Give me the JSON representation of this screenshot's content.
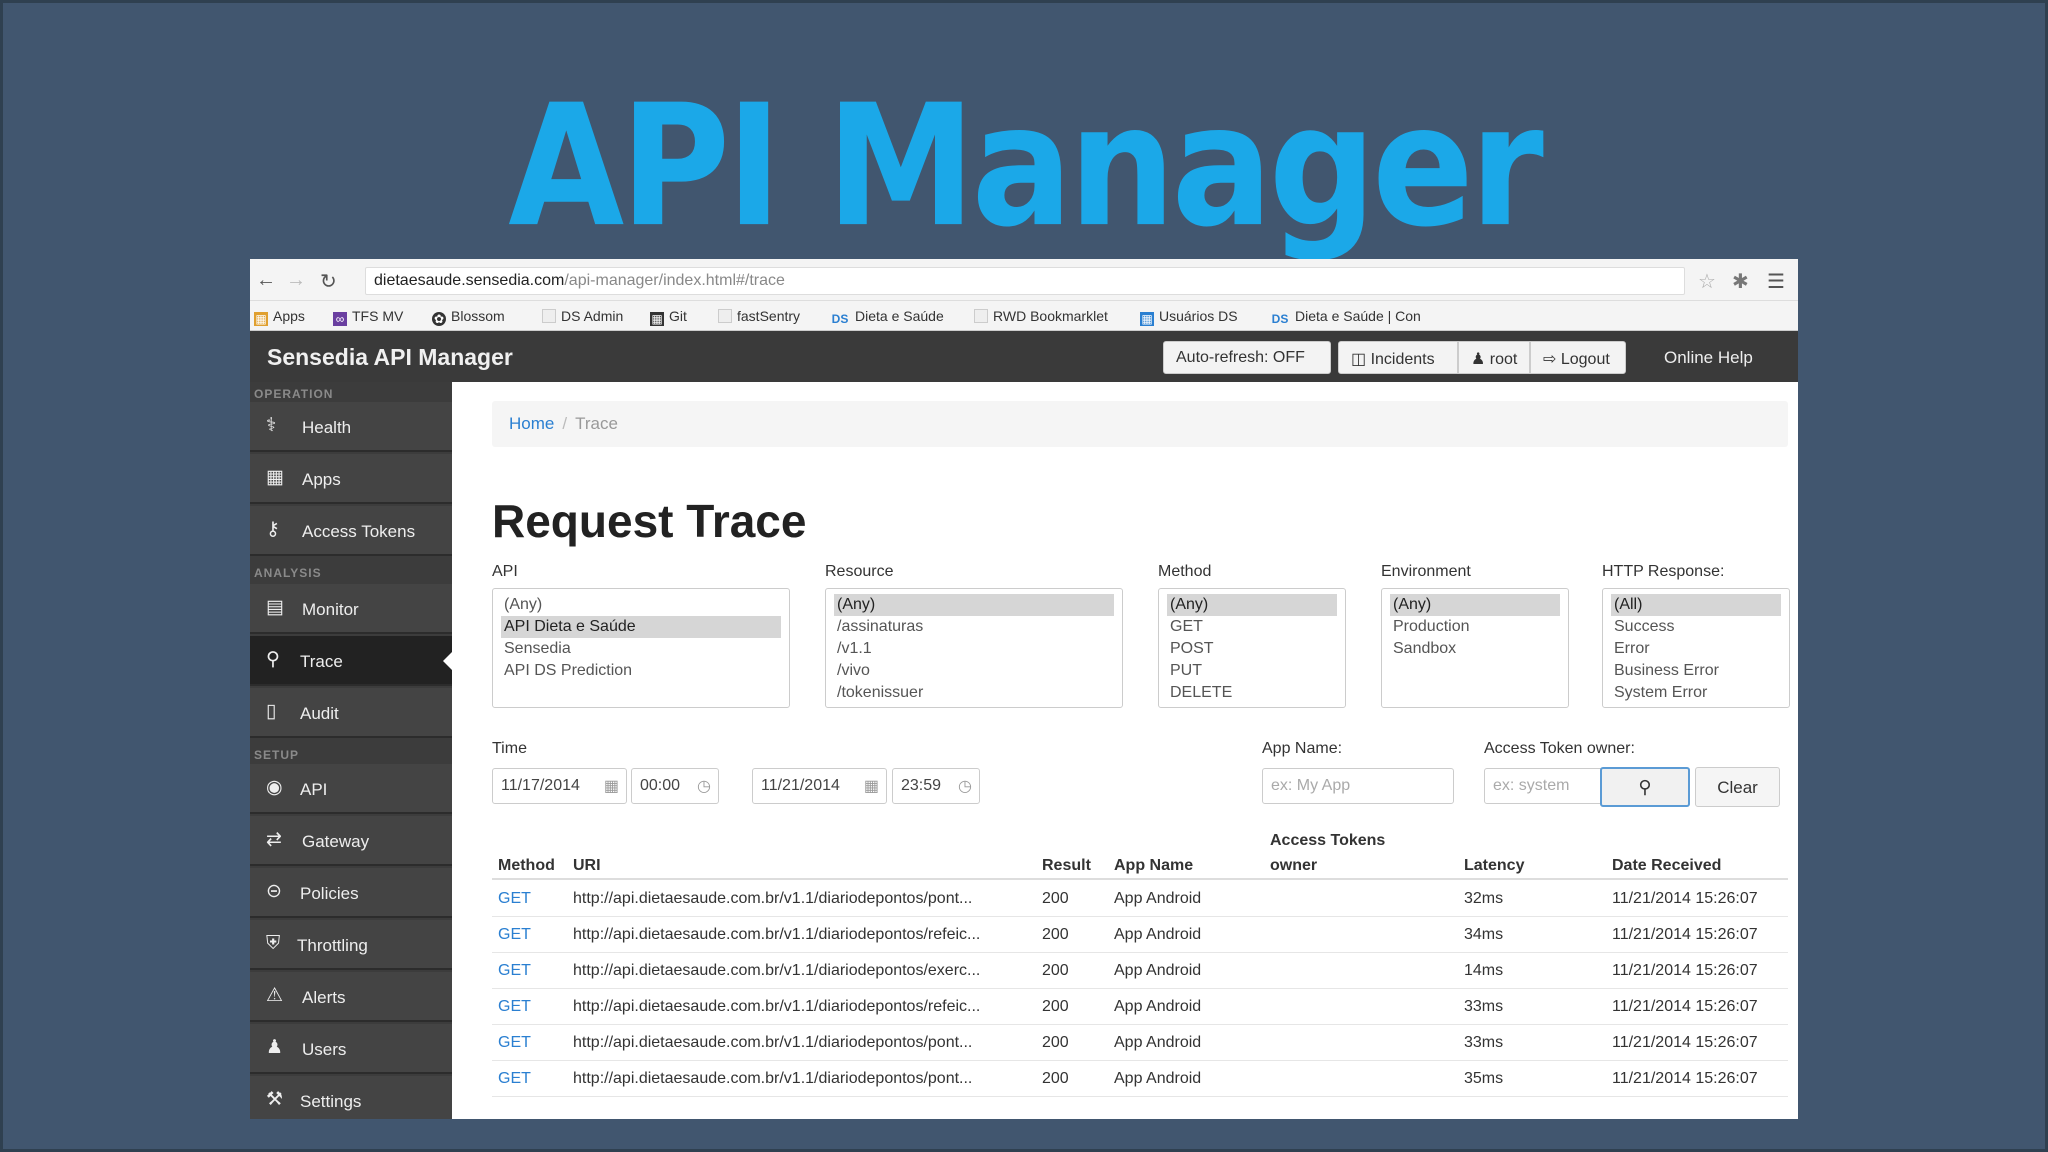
{
  "slide": {
    "title": "API Manager"
  },
  "browser": {
    "url_host": "dietaesaude.sensedia.com",
    "url_path": "/api-manager/index.html#/trace",
    "bookmarks": [
      "Apps",
      "TFS MV",
      "Blossom",
      "DS Admin",
      "Git",
      "fastSentry",
      "Dieta e Saúde",
      "RWD Bookmarklet",
      "Usuários DS",
      "Dieta e Saúde | Con"
    ]
  },
  "header": {
    "brand": "Sensedia API Manager",
    "auto_refresh": "Auto-refresh: OFF",
    "incidents": "Incidents",
    "user": "root",
    "logout": "Logout",
    "online_help": "Online Help"
  },
  "sidebar": {
    "sections": [
      "OPERATION",
      "ANALYSIS",
      "SETUP"
    ],
    "items": [
      {
        "label": "Health",
        "icon": "stethoscope-icon"
      },
      {
        "label": "Apps",
        "icon": "grid-icon"
      },
      {
        "label": "Access Tokens",
        "icon": "key-icon"
      },
      {
        "label": "Monitor",
        "icon": "chart-icon"
      },
      {
        "label": "Trace",
        "icon": "search-icon"
      },
      {
        "label": "Audit",
        "icon": "book-icon"
      },
      {
        "label": "API",
        "icon": "globe-icon"
      },
      {
        "label": "Gateway",
        "icon": "shuffle-icon"
      },
      {
        "label": "Policies",
        "icon": "minus-circle-icon"
      },
      {
        "label": "Throttling",
        "icon": "shield-icon"
      },
      {
        "label": "Alerts",
        "icon": "warning-icon"
      },
      {
        "label": "Users",
        "icon": "users-icon"
      },
      {
        "label": "Settings",
        "icon": "wrench-icon"
      }
    ]
  },
  "breadcrumb": {
    "home": "Home",
    "current": "Trace"
  },
  "page_title": "Request Trace",
  "filters": {
    "api": {
      "label": "API",
      "options": [
        "(Any)",
        "API Dieta e Saúde",
        "Sensedia",
        "API DS Prediction"
      ]
    },
    "resource": {
      "label": "Resource",
      "options": [
        "(Any)",
        "/assinaturas",
        "/v1.1",
        "/vivo",
        "/tokenissuer"
      ]
    },
    "method": {
      "label": "Method",
      "options": [
        "(Any)",
        "GET",
        "POST",
        "PUT",
        "DELETE"
      ]
    },
    "environment": {
      "label": "Environment",
      "options": [
        "(Any)",
        "Production",
        "Sandbox"
      ]
    },
    "http_response": {
      "label": "HTTP Response:",
      "options": [
        "(All)",
        "Success",
        "Error",
        "Business Error",
        "System Error"
      ]
    },
    "time_label": "Time",
    "from_date": "11/17/2014",
    "from_time": "00:00",
    "to_date": "11/21/2014",
    "to_time": "23:59",
    "app_name_label": "App Name:",
    "app_name_placeholder": "ex: My App",
    "token_owner_label": "Access Token owner:",
    "token_owner_placeholder": "ex: system",
    "clear": "Clear"
  },
  "table": {
    "headers": {
      "method": "Method",
      "uri": "URI",
      "result": "Result",
      "app_name": "App Name",
      "token_owner_1": "Access Tokens",
      "token_owner_2": "owner",
      "latency": "Latency",
      "date": "Date Received"
    },
    "rows": [
      {
        "method": "GET",
        "uri": "http://api.dietaesaude.com.br/v1.1/diariodepontos/pont...",
        "result": "200",
        "app": "App Android",
        "latency": "32ms",
        "date": "11/21/2014 15:26:07"
      },
      {
        "method": "GET",
        "uri": "http://api.dietaesaude.com.br/v1.1/diariodepontos/refeic...",
        "result": "200",
        "app": "App Android",
        "latency": "34ms",
        "date": "11/21/2014 15:26:07"
      },
      {
        "method": "GET",
        "uri": "http://api.dietaesaude.com.br/v1.1/diariodepontos/exerc...",
        "result": "200",
        "app": "App Android",
        "latency": "14ms",
        "date": "11/21/2014 15:26:07"
      },
      {
        "method": "GET",
        "uri": "http://api.dietaesaude.com.br/v1.1/diariodepontos/refeic...",
        "result": "200",
        "app": "App Android",
        "latency": "33ms",
        "date": "11/21/2014 15:26:07"
      },
      {
        "method": "GET",
        "uri": "http://api.dietaesaude.com.br/v1.1/diariodepontos/pont...",
        "result": "200",
        "app": "App Android",
        "latency": "33ms",
        "date": "11/21/2014 15:26:07"
      },
      {
        "method": "GET",
        "uri": "http://api.dietaesaude.com.br/v1.1/diariodepontos/pont...",
        "result": "200",
        "app": "App Android",
        "latency": "35ms",
        "date": "11/21/2014 15:26:07"
      }
    ]
  }
}
